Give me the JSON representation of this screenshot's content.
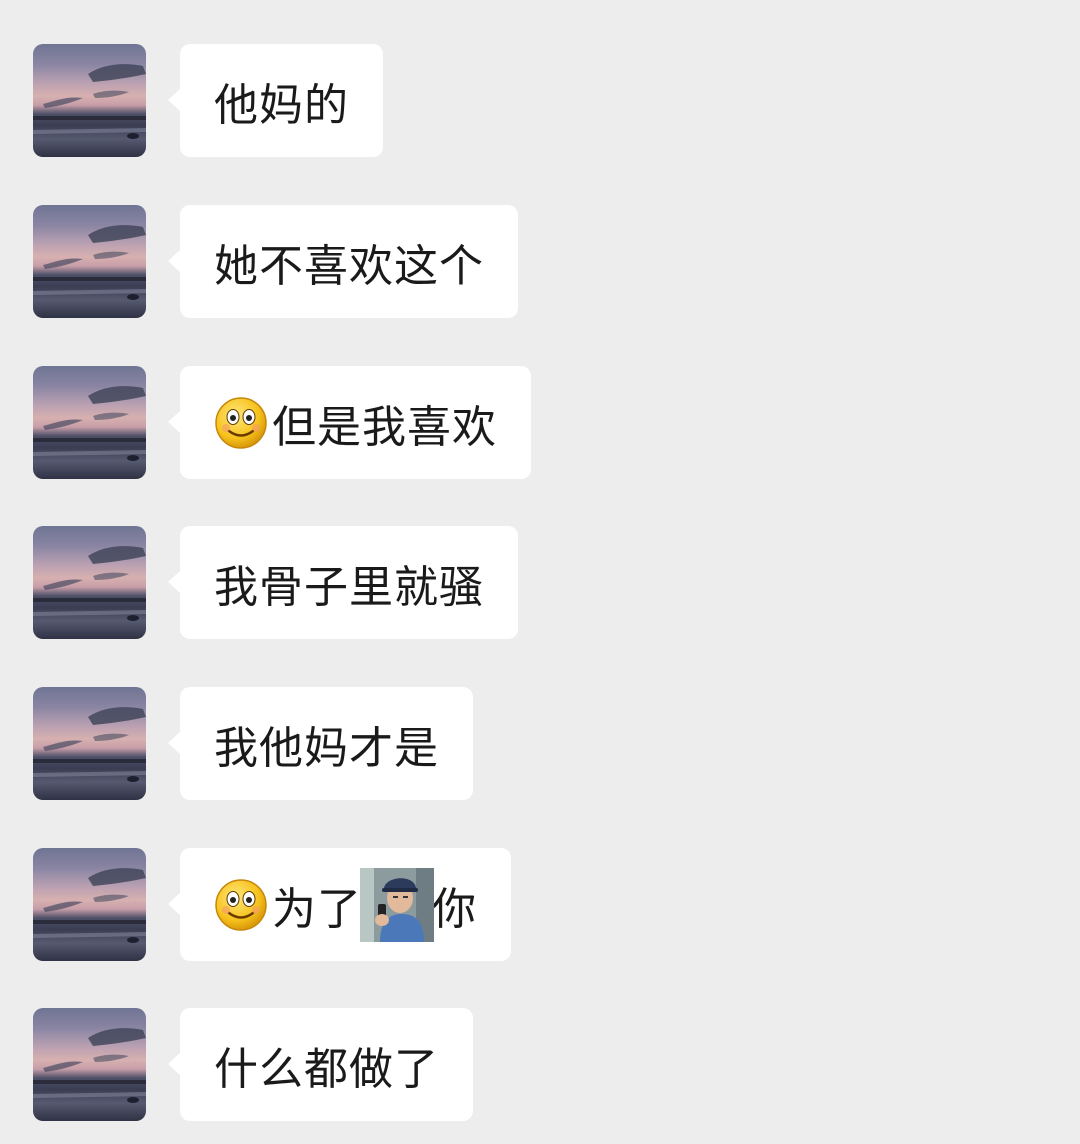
{
  "messages": [
    {
      "text": "他妈的"
    },
    {
      "text": "她不喜欢这个"
    },
    {
      "emoji": "smile-emoji",
      "text": "但是我喜欢"
    },
    {
      "text": "我骨子里就骚"
    },
    {
      "text": "我他妈才是"
    },
    {
      "emoji": "smile-emoji",
      "text_before": "为了",
      "sticker": "old-man-phone-sticker",
      "text_after": "你"
    },
    {
      "text": "什么都做了"
    }
  ],
  "colors": {
    "background": "#ededed",
    "bubble": "#ffffff",
    "text": "#1a1a1a"
  }
}
